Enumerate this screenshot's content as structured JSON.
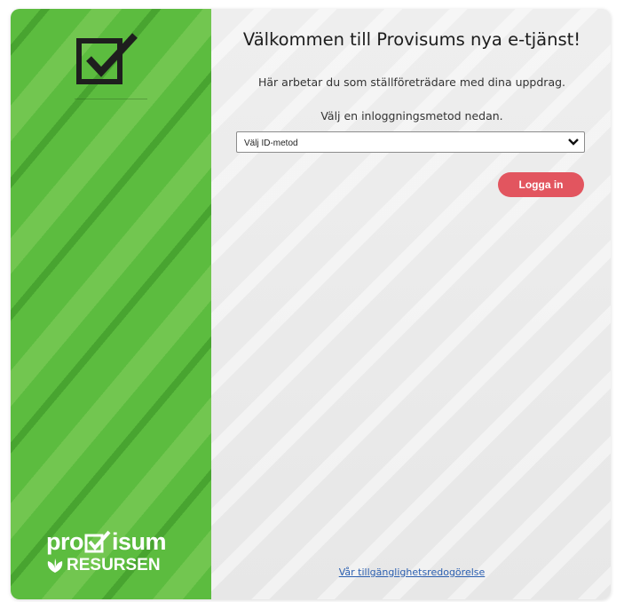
{
  "sidebar": {
    "brand_name": "pro✓isum",
    "brand_name_parts": {
      "before": "pro",
      "after": "isum"
    },
    "brand_sub": "RESURSEN",
    "top_icon": "checkbox-icon",
    "leaf_icon": "leaf-icon"
  },
  "main": {
    "title": "Välkommen till Provisums nya e-tjänst!",
    "subtitle": "Här arbetar du som ställföreträdare med dina uppdrag.",
    "choose_label": "Välj en inloggningsmetod nedan.",
    "id_select": {
      "selected": "Välj ID-metod",
      "options": [
        "Välj ID-metod"
      ]
    },
    "login_button": "Logga in",
    "accessibility_link": "Vår tillgänglighetsredogörelse"
  },
  "colors": {
    "sidebar_green": "#5cbc3f",
    "login_button": "#e2555f",
    "link": "#2b5fb0",
    "background": "#eeeeee"
  }
}
